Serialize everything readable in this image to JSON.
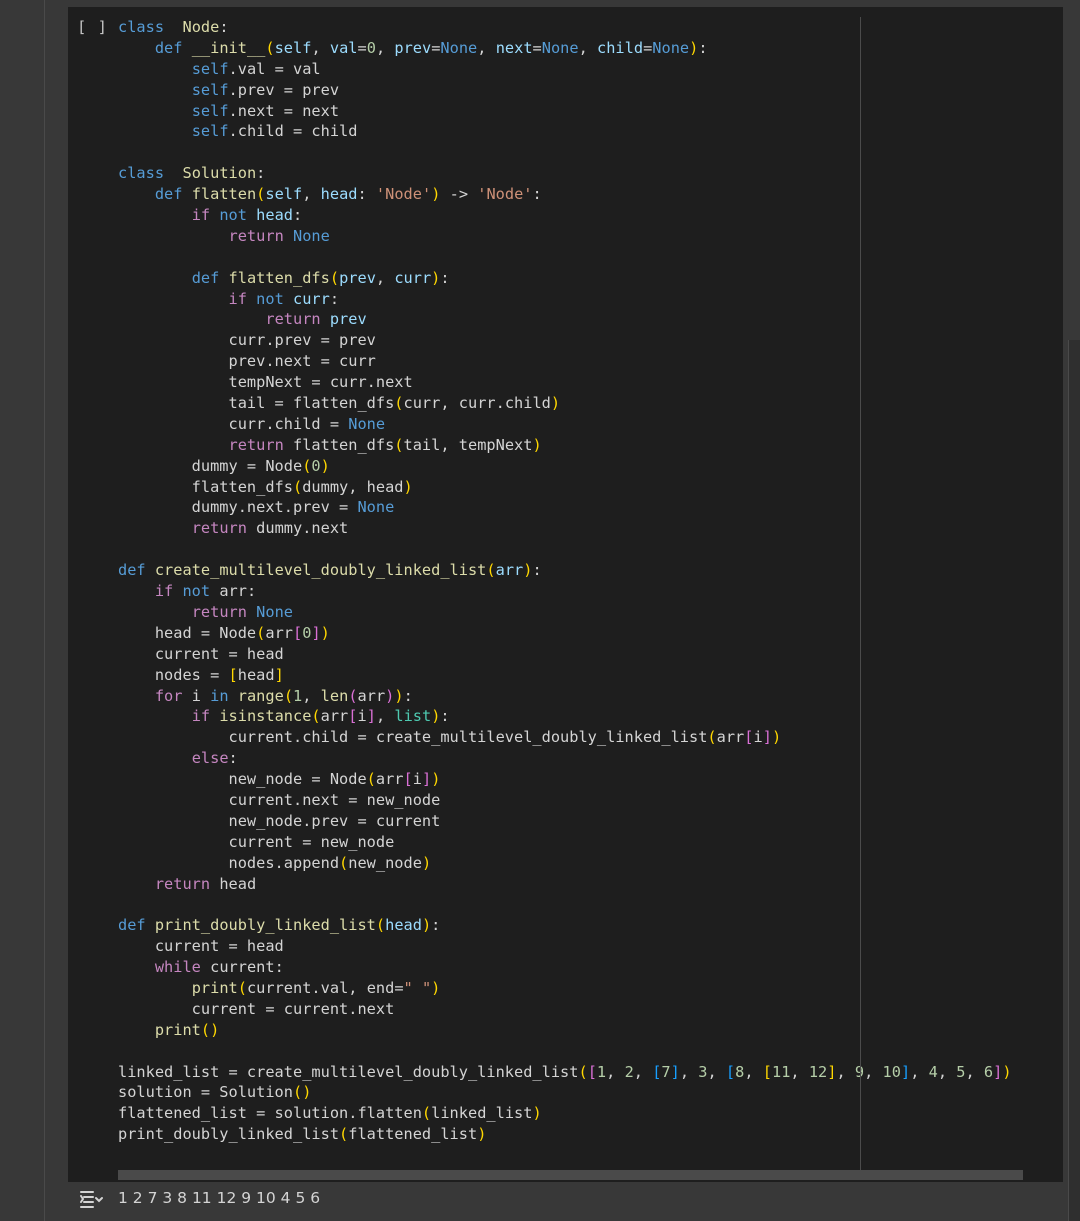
{
  "cell": {
    "run_indicator": "[ ]",
    "output_text": "1 2 7 3 8 11 12 9 10 4 5 6",
    "icons": {
      "output": "output-toggle-icon"
    }
  },
  "theme": {
    "keyword": "#c586c0",
    "decl": "#569cd6",
    "name": "#dcdcaa",
    "param": "#9cdcfe",
    "string": "#ce9178",
    "number": "#b5cea8",
    "bracket1": "#ffd700",
    "bracket2": "#da70d6",
    "bracket3": "#179fff",
    "builtin": "#4ec9b0"
  },
  "code_lines": [
    [
      [
        "decl",
        "class"
      ],
      [
        "",
        "  "
      ],
      [
        "name",
        "Node"
      ],
      [
        "",
        ":"
      ]
    ],
    [
      [
        "",
        "    "
      ],
      [
        "decl",
        "def"
      ],
      [
        "",
        ""
      ],
      [
        "",
        ""
      ],
      [
        "name",
        " __init__"
      ],
      [
        "bracket1",
        "("
      ],
      [
        "param",
        "self"
      ],
      [
        "",
        ", "
      ],
      [
        "param",
        "val"
      ],
      [
        "",
        "="
      ],
      [
        "number",
        "0"
      ],
      [
        "",
        ", "
      ],
      [
        "param",
        "prev"
      ],
      [
        "",
        "="
      ],
      [
        "decl",
        "None"
      ],
      [
        "",
        ", "
      ],
      [
        "param",
        "next"
      ],
      [
        "",
        "="
      ],
      [
        "decl",
        "None"
      ],
      [
        "",
        ", "
      ],
      [
        "param",
        "child"
      ],
      [
        "",
        "="
      ],
      [
        "decl",
        "None"
      ],
      [
        "bracket1",
        ")"
      ],
      [
        "",
        ":"
      ]
    ],
    [
      [
        "",
        "        "
      ],
      [
        "decl",
        "self"
      ],
      [
        "",
        ".val = val"
      ]
    ],
    [
      [
        "",
        "        "
      ],
      [
        "decl",
        "self"
      ],
      [
        "",
        ".prev = prev"
      ]
    ],
    [
      [
        "",
        "        "
      ],
      [
        "decl",
        "self"
      ],
      [
        "",
        ".next = next"
      ]
    ],
    [
      [
        "",
        "        "
      ],
      [
        "decl",
        "self"
      ],
      [
        "",
        ".child = child"
      ]
    ],
    [
      [
        "",
        ""
      ]
    ],
    [
      [
        "decl",
        "class"
      ],
      [
        "",
        "  "
      ],
      [
        "name",
        "Solution"
      ],
      [
        "",
        ":"
      ]
    ],
    [
      [
        "",
        "    "
      ],
      [
        "decl",
        "def"
      ],
      [
        "name",
        " flatten"
      ],
      [
        "bracket1",
        "("
      ],
      [
        "param",
        "self"
      ],
      [
        "",
        ", "
      ],
      [
        "param",
        "head"
      ],
      [
        "",
        ": "
      ],
      [
        "string",
        "'Node'"
      ],
      [
        "bracket1",
        ")"
      ],
      [
        "",
        " -> "
      ],
      [
        "string",
        "'Node'"
      ],
      [
        "",
        ":"
      ]
    ],
    [
      [
        "",
        "        "
      ],
      [
        "keyword",
        "if"
      ],
      [
        "decl",
        " not"
      ],
      [
        "param",
        " head"
      ],
      [
        "",
        ":"
      ]
    ],
    [
      [
        "",
        "            "
      ],
      [
        "keyword",
        "return"
      ],
      [
        "decl",
        " None"
      ]
    ],
    [
      [
        "",
        ""
      ]
    ],
    [
      [
        "",
        "        "
      ],
      [
        "decl",
        "def"
      ],
      [
        "name",
        " flatten_dfs"
      ],
      [
        "bracket1",
        "("
      ],
      [
        "param",
        "prev"
      ],
      [
        "",
        ", "
      ],
      [
        "param",
        "curr"
      ],
      [
        "bracket1",
        ")"
      ],
      [
        "",
        ":"
      ]
    ],
    [
      [
        "",
        "            "
      ],
      [
        "keyword",
        "if"
      ],
      [
        "decl",
        " not"
      ],
      [
        "param",
        " curr"
      ],
      [
        "",
        ":"
      ]
    ],
    [
      [
        "",
        "                "
      ],
      [
        "keyword",
        "return"
      ],
      [
        "param",
        " prev"
      ]
    ],
    [
      [
        "",
        "            curr.prev = prev"
      ]
    ],
    [
      [
        "",
        "            prev.next = curr"
      ]
    ],
    [
      [
        "",
        "            tempNext = curr.next"
      ]
    ],
    [
      [
        "",
        "            tail = flatten_dfs"
      ],
      [
        "bracket1",
        "("
      ],
      [
        "",
        "curr, curr.child"
      ],
      [
        "bracket1",
        ")"
      ]
    ],
    [
      [
        "",
        "            curr.child = "
      ],
      [
        "decl",
        "None"
      ]
    ],
    [
      [
        "",
        "            "
      ],
      [
        "keyword",
        "return"
      ],
      [
        "",
        " flatten_dfs"
      ],
      [
        "bracket1",
        "("
      ],
      [
        "",
        "tail, tempNext"
      ],
      [
        "bracket1",
        ")"
      ]
    ],
    [
      [
        "",
        "        dummy = Node"
      ],
      [
        "bracket1",
        "("
      ],
      [
        "number",
        "0"
      ],
      [
        "bracket1",
        ")"
      ]
    ],
    [
      [
        "",
        "        flatten_dfs"
      ],
      [
        "bracket1",
        "("
      ],
      [
        "",
        "dummy, head"
      ],
      [
        "bracket1",
        ")"
      ]
    ],
    [
      [
        "",
        "        dummy.next.prev = "
      ],
      [
        "decl",
        "None"
      ]
    ],
    [
      [
        "",
        "        "
      ],
      [
        "keyword",
        "return"
      ],
      [
        "",
        " dummy.next"
      ]
    ],
    [
      [
        "",
        ""
      ]
    ],
    [
      [
        "decl",
        "def"
      ],
      [
        "name",
        " create_multilevel_doubly_linked_list"
      ],
      [
        "bracket1",
        "("
      ],
      [
        "param",
        "arr"
      ],
      [
        "bracket1",
        ")"
      ],
      [
        "",
        ":"
      ]
    ],
    [
      [
        "",
        "    "
      ],
      [
        "keyword",
        "if"
      ],
      [
        "decl",
        " not"
      ],
      [
        "",
        " arr:"
      ]
    ],
    [
      [
        "",
        "        "
      ],
      [
        "keyword",
        "return"
      ],
      [
        "decl",
        " None"
      ]
    ],
    [
      [
        "",
        "    head = Node"
      ],
      [
        "bracket1",
        "("
      ],
      [
        "",
        "arr"
      ],
      [
        "bracket2",
        "["
      ],
      [
        "number",
        "0"
      ],
      [
        "bracket2",
        "]"
      ],
      [
        "bracket1",
        ")"
      ]
    ],
    [
      [
        "",
        "    current = head"
      ]
    ],
    [
      [
        "",
        "    nodes = "
      ],
      [
        "bracket1",
        "["
      ],
      [
        "",
        "head"
      ],
      [
        "bracket1",
        "]"
      ]
    ],
    [
      [
        "",
        "    "
      ],
      [
        "keyword",
        "for"
      ],
      [
        "",
        " i "
      ],
      [
        "decl",
        "in"
      ],
      [
        "name",
        " range"
      ],
      [
        "bracket1",
        "("
      ],
      [
        "number",
        "1"
      ],
      [
        "",
        ", "
      ],
      [
        "name",
        "len"
      ],
      [
        "bracket2",
        "("
      ],
      [
        "",
        "arr"
      ],
      [
        "bracket2",
        ")"
      ],
      [
        "bracket1",
        ")"
      ],
      [
        "",
        ":"
      ]
    ],
    [
      [
        "",
        "        "
      ],
      [
        "keyword",
        "if"
      ],
      [
        "name",
        " isinstance"
      ],
      [
        "bracket1",
        "("
      ],
      [
        "",
        "arr"
      ],
      [
        "bracket2",
        "["
      ],
      [
        "",
        "i"
      ],
      [
        "bracket2",
        "]"
      ],
      [
        "",
        ", "
      ],
      [
        "builtin",
        "list"
      ],
      [
        "bracket1",
        ")"
      ],
      [
        "",
        ":"
      ]
    ],
    [
      [
        "",
        "            current.child = create_multilevel_doubly_linked_list"
      ],
      [
        "bracket1",
        "("
      ],
      [
        "",
        "arr"
      ],
      [
        "bracket2",
        "["
      ],
      [
        "",
        "i"
      ],
      [
        "bracket2",
        "]"
      ],
      [
        "bracket1",
        ")"
      ]
    ],
    [
      [
        "",
        "        "
      ],
      [
        "keyword",
        "else"
      ],
      [
        "",
        ":"
      ]
    ],
    [
      [
        "",
        "            new_node = Node"
      ],
      [
        "bracket1",
        "("
      ],
      [
        "",
        "arr"
      ],
      [
        "bracket2",
        "["
      ],
      [
        "",
        "i"
      ],
      [
        "bracket2",
        "]"
      ],
      [
        "bracket1",
        ")"
      ]
    ],
    [
      [
        "",
        "            current.next = new_node"
      ]
    ],
    [
      [
        "",
        "            new_node.prev = current"
      ]
    ],
    [
      [
        "",
        "            current = new_node"
      ]
    ],
    [
      [
        "",
        "            nodes.append"
      ],
      [
        "bracket1",
        "("
      ],
      [
        "",
        "new_node"
      ],
      [
        "bracket1",
        ")"
      ]
    ],
    [
      [
        "",
        "    "
      ],
      [
        "keyword",
        "return"
      ],
      [
        "",
        " head"
      ]
    ],
    [
      [
        "",
        ""
      ]
    ],
    [
      [
        "decl",
        "def"
      ],
      [
        "name",
        " print_doubly_linked_list"
      ],
      [
        "bracket1",
        "("
      ],
      [
        "param",
        "head"
      ],
      [
        "bracket1",
        ")"
      ],
      [
        "",
        ":"
      ]
    ],
    [
      [
        "",
        "    current = head"
      ]
    ],
    [
      [
        "",
        "    "
      ],
      [
        "keyword",
        "while"
      ],
      [
        "",
        " current:"
      ]
    ],
    [
      [
        "",
        "        "
      ],
      [
        "name",
        "print"
      ],
      [
        "bracket1",
        "("
      ],
      [
        "",
        "current.val, end="
      ],
      [
        "string",
        "\" \""
      ],
      [
        "bracket1",
        ")"
      ]
    ],
    [
      [
        "",
        "        current = current.next"
      ]
    ],
    [
      [
        "",
        "    "
      ],
      [
        "name",
        "print"
      ],
      [
        "bracket1",
        "()"
      ]
    ],
    [
      [
        "",
        ""
      ]
    ],
    [
      [
        "",
        "linked_list = create_multilevel_doubly_linked_list"
      ],
      [
        "bracket1",
        "("
      ],
      [
        "bracket2",
        "["
      ],
      [
        "number",
        "1"
      ],
      [
        "",
        ", "
      ],
      [
        "number",
        "2"
      ],
      [
        "",
        ", "
      ],
      [
        "bracket3",
        "["
      ],
      [
        "number",
        "7"
      ],
      [
        "bracket3",
        "]"
      ],
      [
        "",
        ", "
      ],
      [
        "number",
        "3"
      ],
      [
        "",
        ", "
      ],
      [
        "bracket3",
        "["
      ],
      [
        "number",
        "8"
      ],
      [
        "",
        ", "
      ],
      [
        "bracket1",
        "["
      ],
      [
        "number",
        "11"
      ],
      [
        "",
        ", "
      ],
      [
        "number",
        "12"
      ],
      [
        "bracket1",
        "]"
      ],
      [
        "",
        ", "
      ],
      [
        "number",
        "9"
      ],
      [
        "",
        ", "
      ],
      [
        "number",
        "10"
      ],
      [
        "bracket3",
        "]"
      ],
      [
        "",
        ", "
      ],
      [
        "number",
        "4"
      ],
      [
        "",
        ", "
      ],
      [
        "number",
        "5"
      ],
      [
        "",
        ", "
      ],
      [
        "number",
        "6"
      ],
      [
        "bracket2",
        "]"
      ],
      [
        "bracket1",
        ")"
      ]
    ],
    [
      [
        "",
        "solution = Solution"
      ],
      [
        "bracket1",
        "()"
      ]
    ],
    [
      [
        "",
        "flattened_list = solution.flatten"
      ],
      [
        "bracket1",
        "("
      ],
      [
        "",
        "linked_list"
      ],
      [
        "bracket1",
        ")"
      ]
    ],
    [
      [
        "",
        "print_doubly_linked_list"
      ],
      [
        "bracket1",
        "("
      ],
      [
        "",
        "flattened_list"
      ],
      [
        "bracket1",
        ")"
      ]
    ]
  ]
}
